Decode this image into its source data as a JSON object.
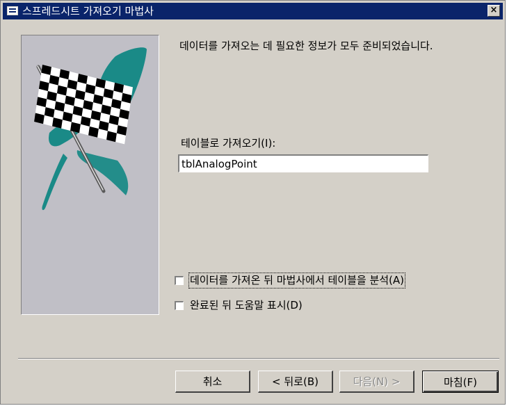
{
  "window": {
    "title": "스프레드시트 가져오기 마법사",
    "close_glyph": "×"
  },
  "content": {
    "message": "데이터를 가져오는 데 필요한 정보가 모두 준비되었습니다.",
    "table_label": "테이블로 가져오기(I):",
    "table_value": "tblAnalogPoint",
    "analyze_checkbox": {
      "label": "데이터를 가져온 뒤 마법사에서 테이블을 분석(A)",
      "checked": false
    },
    "help_checkbox": {
      "label": "완료된 뒤 도움말 표시(D)",
      "checked": false
    }
  },
  "buttons": {
    "cancel": "취소",
    "back": "< 뒤로(B)",
    "next": "다음(N) >",
    "finish": "마침(F)"
  },
  "colors": {
    "titlebar": "#0a246a",
    "dialog_bg": "#d4d0c8",
    "art_panel_bg": "#c0bfc6",
    "teal_brush": "#1a8a87"
  }
}
